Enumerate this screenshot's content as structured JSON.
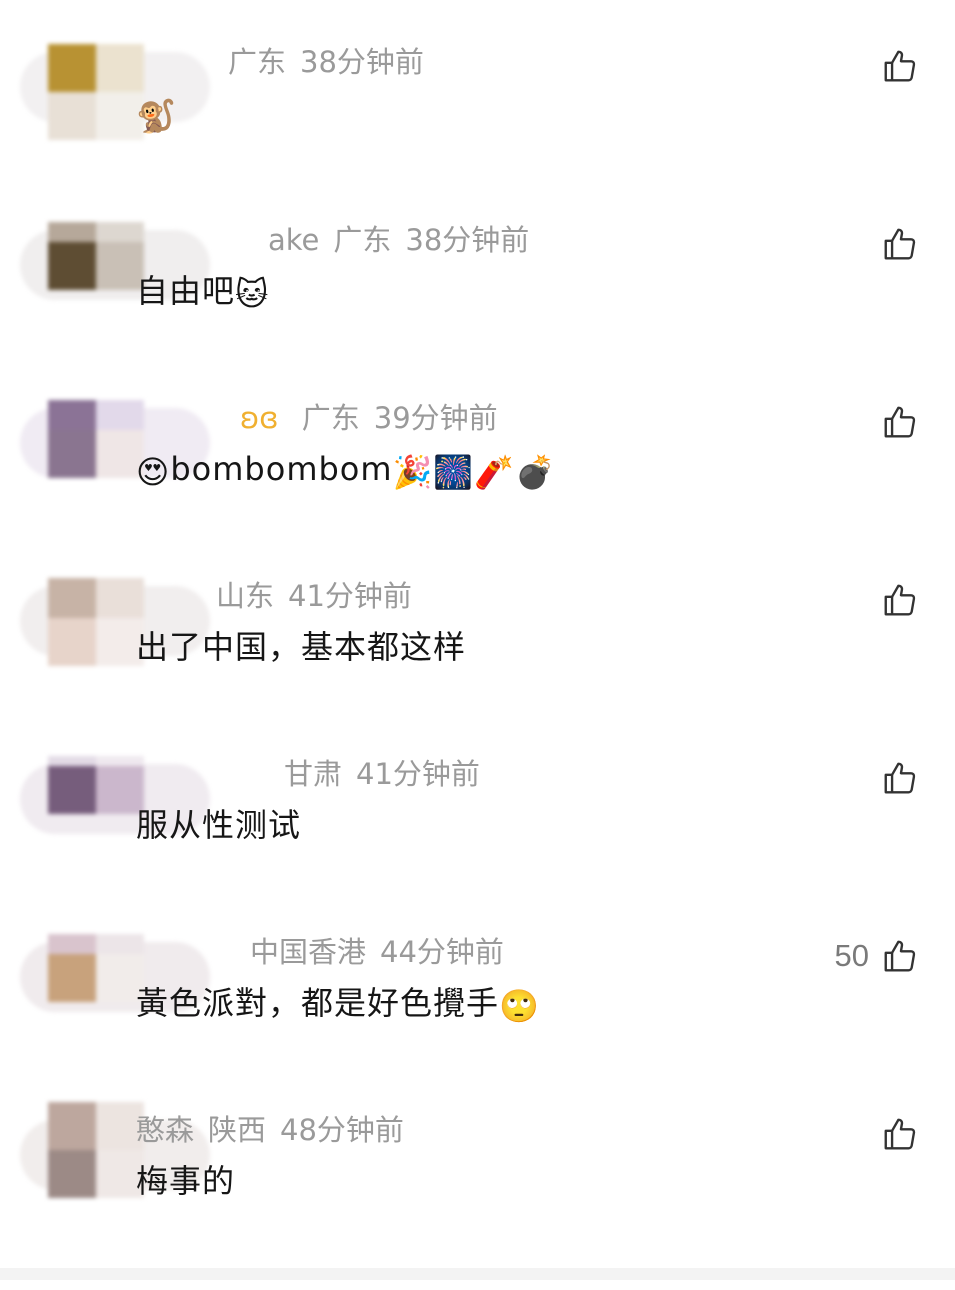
{
  "comments": [
    {
      "name": "",
      "location": "广东",
      "time": "38分钟前",
      "text": "",
      "emojis": [
        "🐒"
      ],
      "likes": ""
    },
    {
      "name": "ake",
      "location": "广东",
      "time": "38分钟前",
      "text": "自由吧",
      "emojis": [
        "🐱"
      ],
      "likes": ""
    },
    {
      "name": "",
      "location": "广东",
      "time": "39分钟前",
      "text": "bombombom",
      "lead_emoji": "😍",
      "emojis": [
        "🎉",
        "🎆",
        "🧨",
        "💣"
      ],
      "likes": ""
    },
    {
      "name": "",
      "location": "山东",
      "time": "41分钟前",
      "text": "出了中国，基本都这样",
      "emojis": [],
      "likes": ""
    },
    {
      "name": "",
      "location": "甘肃",
      "time": "41分钟前",
      "text": "服从性测试",
      "emojis": [],
      "likes": ""
    },
    {
      "name": "",
      "location": "中国香港",
      "time": "44分钟前",
      "text": "黃色派對，都是好色攪手",
      "emojis": [
        "🙄"
      ],
      "likes": "50"
    },
    {
      "name": "憨森",
      "location": "陕西",
      "time": "48分钟前",
      "text": "梅事的",
      "emojis": [],
      "likes": ""
    }
  ],
  "colors": {
    "meta": "#9a9a9a",
    "text": "#161616",
    "icon": "#333333"
  },
  "icons": {
    "like": "thumbs-up-icon"
  }
}
